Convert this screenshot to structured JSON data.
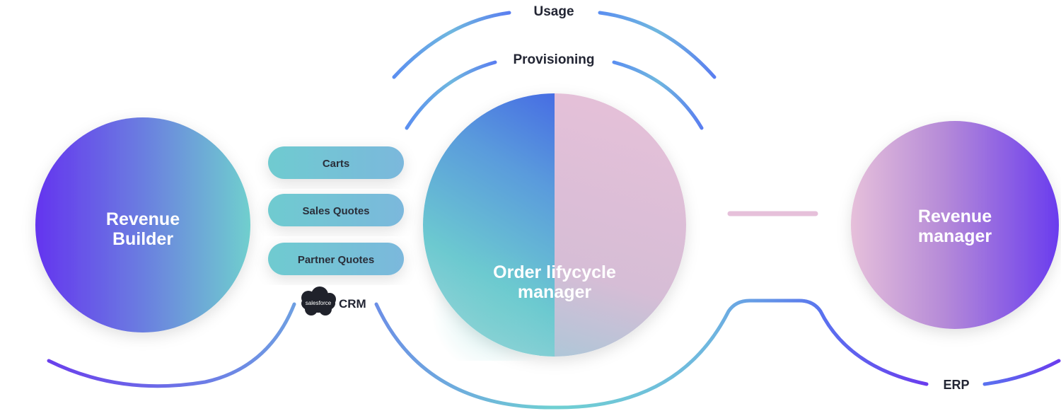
{
  "nodes": {
    "revenue_builder": {
      "line1": "Revenue",
      "line2": "Builder"
    },
    "order_manager": {
      "line1": "Order lifycycle",
      "line2": "manager"
    },
    "revenue_manager": {
      "line1": "Revenue",
      "line2": "manager"
    }
  },
  "channels": [
    "Carts",
    "Sales Quotes",
    "Partner Quotes"
  ],
  "arcs": {
    "usage": "Usage",
    "provisioning": "Provisioning",
    "erp": "ERP"
  },
  "crm": {
    "logo_text": "salesforce",
    "label": "CRM"
  },
  "colors": {
    "purple": "#6a35ee",
    "teal": "#6fcbd0",
    "blue": "#3b4fe8",
    "pink": "#e6bfd8",
    "pill": "#78c4d4",
    "dark_text": "#222533"
  },
  "icons": {
    "crm_logo": "salesforce-cloud-icon"
  }
}
